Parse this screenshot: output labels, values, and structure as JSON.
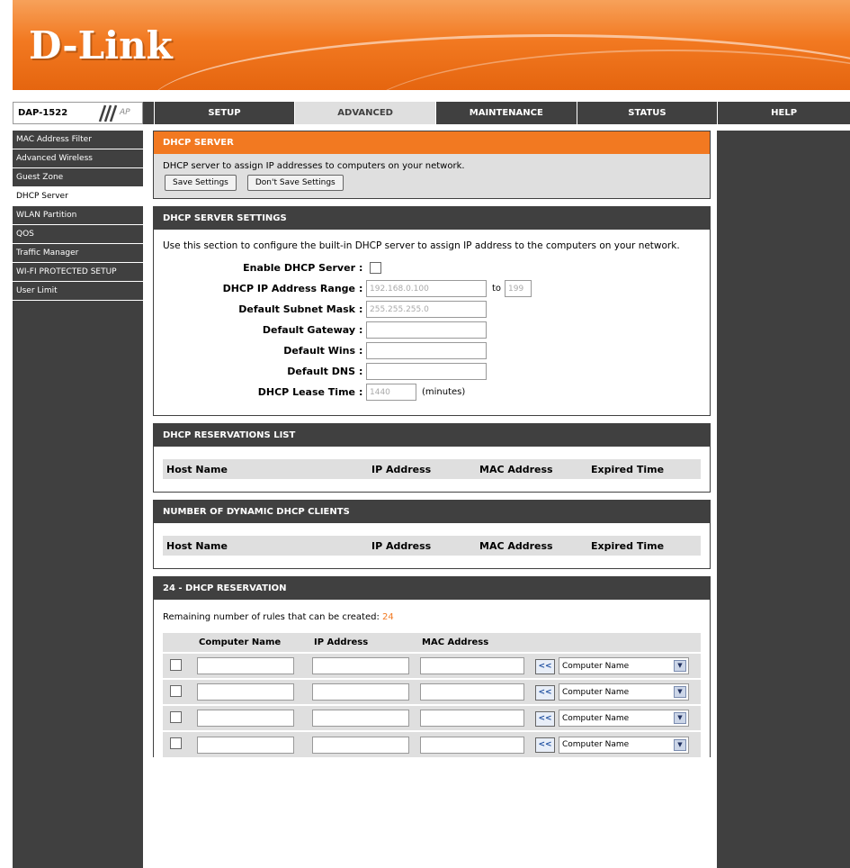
{
  "brand": {
    "logo": "D-Link"
  },
  "model": {
    "name": "DAP-1522",
    "suffix": "AP"
  },
  "nav": {
    "tabs": [
      "SETUP",
      "ADVANCED",
      "MAINTENANCE",
      "STATUS",
      "HELP"
    ],
    "active": "ADVANCED"
  },
  "sidebar": {
    "items": [
      {
        "label": "MAC Address Filter"
      },
      {
        "label": "Advanced Wireless"
      },
      {
        "label": "Guest Zone"
      },
      {
        "label": "DHCP Server"
      },
      {
        "label": "WLAN Partition"
      },
      {
        "label": "QOS"
      },
      {
        "label": "Traffic Manager"
      },
      {
        "label": "WI-FI PROTECTED SETUP"
      },
      {
        "label": "User Limit"
      }
    ],
    "active": "DHCP Server"
  },
  "dhcp_server": {
    "title": "DHCP SERVER",
    "description": "DHCP server to assign IP addresses to computers on your network.",
    "save_label": "Save Settings",
    "dont_save_label": "Don't Save Settings"
  },
  "settings": {
    "title": "DHCP SERVER SETTINGS",
    "description": "Use this section to configure the built-in DHCP server to assign IP address to the computers on your network.",
    "enable_label": "Enable DHCP Server",
    "range_label": "DHCP IP Address Range",
    "range_start": "192.168.0.100",
    "range_to": "to",
    "range_end": "199",
    "subnet_label": "Default Subnet Mask",
    "subnet_value": "255.255.255.0",
    "gateway_label": "Default Gateway",
    "gateway_value": "",
    "wins_label": "Default Wins",
    "wins_value": "",
    "dns_label": "Default DNS",
    "dns_value": "",
    "lease_label": "DHCP Lease Time",
    "lease_value": "1440",
    "lease_unit": "(minutes)",
    "separator": ":"
  },
  "reservations_list": {
    "title": "DHCP RESERVATIONS LIST",
    "columns": [
      "Host Name",
      "IP Address",
      "MAC Address",
      "Expired Time"
    ]
  },
  "dynamic_clients": {
    "title": "NUMBER OF DYNAMIC DHCP CLIENTS",
    "columns": [
      "Host Name",
      "IP Address",
      "MAC Address",
      "Expired Time"
    ]
  },
  "reservation": {
    "title": "24 - DHCP RESERVATION",
    "remaining_text": "Remaining number of rules that can be created:",
    "remaining_count": "24",
    "columns": [
      "Computer Name",
      "IP Address",
      "MAC Address"
    ],
    "copy_label": "<<",
    "rows": [
      {
        "select": "Computer Name"
      },
      {
        "select": "Computer Name"
      },
      {
        "select": "Computer Name"
      },
      {
        "select": "Computer Name"
      }
    ]
  }
}
